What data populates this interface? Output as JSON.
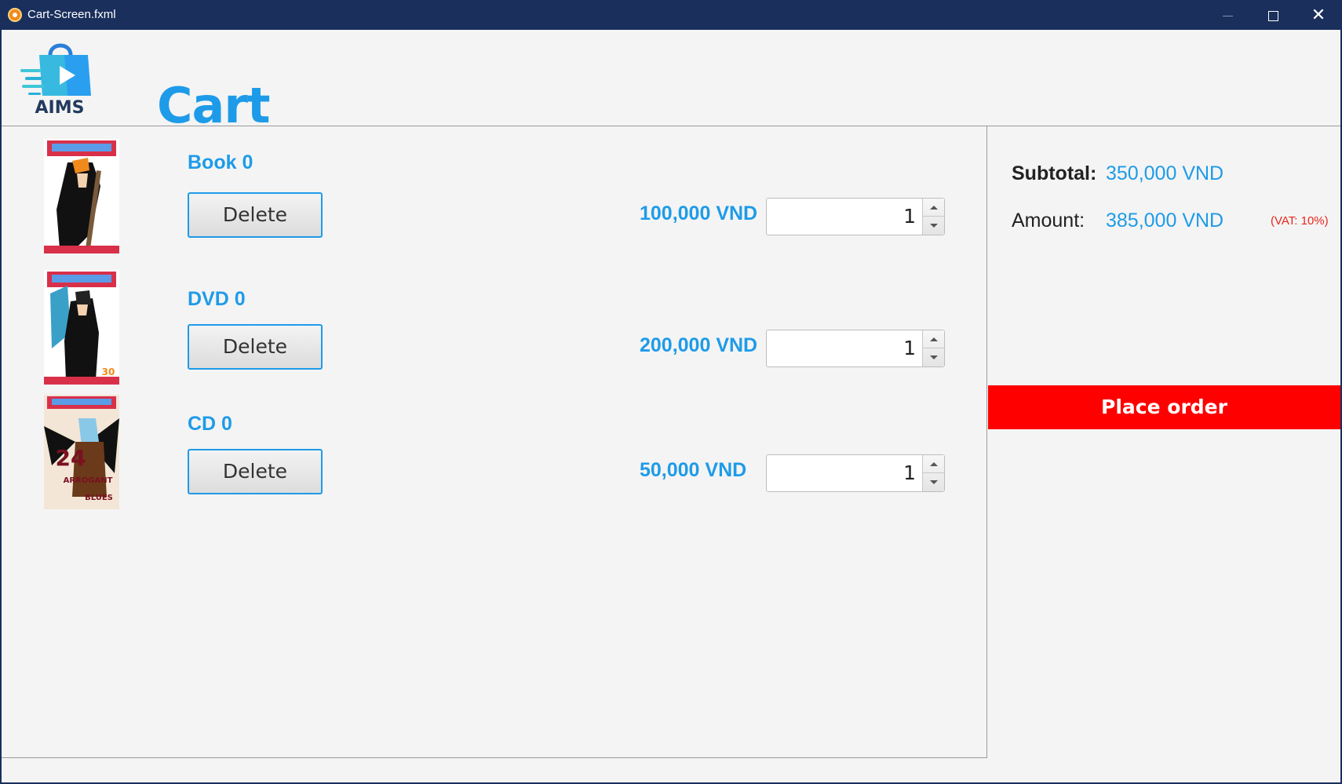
{
  "window": {
    "title": "Cart-Screen.fxml",
    "close_glyph": "✕"
  },
  "header": {
    "logo_text": "AIMS",
    "title": "Cart"
  },
  "cart": {
    "items": [
      {
        "name": "Book 0",
        "delete_label": "Delete",
        "price": "100,000 VND",
        "quantity": "1"
      },
      {
        "name": "DVD 0",
        "delete_label": "Delete",
        "price": "200,000 VND",
        "quantity": "1"
      },
      {
        "name": "CD 0",
        "delete_label": "Delete",
        "price": "50,000 VND",
        "quantity": "1"
      }
    ]
  },
  "summary": {
    "subtotal_label": "Subtotal:",
    "subtotal_value": "350,000 VND",
    "amount_label": "Amount:",
    "amount_value": "385,000 VND",
    "vat_note": "(VAT: 10%)",
    "place_order_label": "Place order"
  },
  "colors": {
    "accent": "#1e9be8",
    "titlebar": "#1a2f5c",
    "place_order": "#ff0000",
    "vat": "#e8261c"
  }
}
